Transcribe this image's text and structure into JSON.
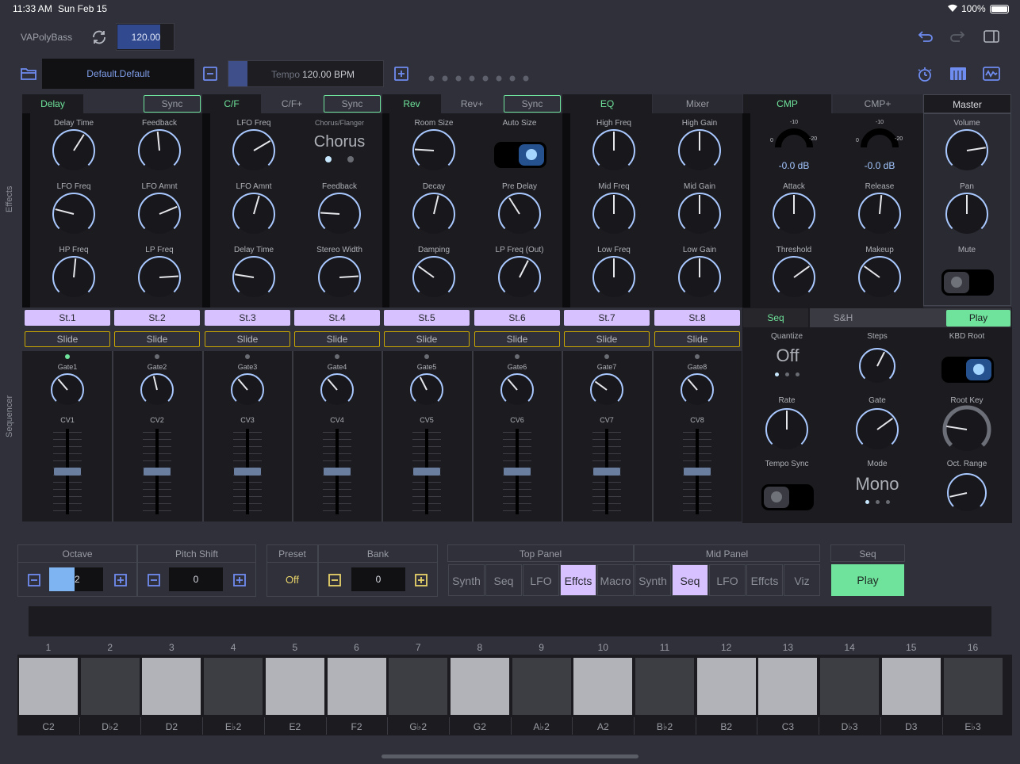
{
  "status_bar": {
    "time": "11:33 AM",
    "date": "Sun Feb 15",
    "battery": "100%"
  },
  "toolbar": {
    "preset_name": "VAPolyBass",
    "tempo_value": "120.00",
    "patch_name": "Default.Default",
    "tempo_label": "Tempo",
    "tempo_bpm": "120.00 BPM",
    "page_dots": 8
  },
  "effects_side_label": "Effects",
  "sequencer_side_label": "Sequencer",
  "effect_tabs": [
    {
      "label": "Delay",
      "active": true
    },
    {
      "label": "Sync",
      "outlined": true
    },
    {
      "label": "C/F",
      "active": true
    },
    {
      "label": "C/F+"
    },
    {
      "label": "Sync",
      "outlined": true
    },
    {
      "label": "Rev",
      "active": true
    },
    {
      "label": "Rev+"
    },
    {
      "label": "Sync",
      "outlined": true
    },
    {
      "label": "EQ",
      "active": true
    },
    {
      "label": "Mixer"
    },
    {
      "label": "CMP",
      "active": true
    },
    {
      "label": "CMP+"
    },
    {
      "label": "Master",
      "active_white": true
    }
  ],
  "knob_labels": {
    "delay": [
      "Delay Time",
      "Feedback",
      "LFO Freq",
      "LFO Amnt",
      "HP Freq",
      "LP Freq"
    ],
    "chorus": [
      "LFO Freq",
      "LFO Amnt",
      "Feedback",
      "Delay Time",
      "Stereo Width"
    ],
    "chorus_small_label": "Chorus/Flanger",
    "chorus_mode": "Chorus",
    "reverb": [
      "Room Size",
      "Auto Size",
      "Decay",
      "Pre Delay",
      "Damping",
      "LP Freq (Out)"
    ],
    "eq": [
      "High Freq",
      "High Gain",
      "Mid Freq",
      "Mid Gain",
      "Low Freq",
      "Low Gain"
    ],
    "cmp": [
      "Attack",
      "Release",
      "Threshold",
      "Makeup"
    ],
    "cmp_meters": [
      {
        "left": "0",
        "top": "-10",
        "right": "-20",
        "value": "-0.0 dB"
      },
      {
        "left": "0",
        "top": "-10",
        "right": "-20",
        "value": "-0.0 dB"
      }
    ],
    "master": [
      "Volume",
      "Pan",
      "Mute"
    ]
  },
  "steps": {
    "labels": [
      "St.1",
      "St.2",
      "St.3",
      "St.4",
      "St.5",
      "St.6",
      "St.7",
      "St.8"
    ],
    "slide_label": "Slide",
    "gates": [
      "Gate1",
      "Gate2",
      "Gate3",
      "Gate4",
      "Gate5",
      "Gate6",
      "Gate7",
      "Gate8"
    ],
    "cvs": [
      "CV1",
      "CV2",
      "CV3",
      "CV4",
      "CV5",
      "CV6",
      "CV7",
      "CV8"
    ]
  },
  "seq_panel": {
    "tabs": [
      "Seq",
      "S&H"
    ],
    "play": "Play",
    "labels": [
      "Quantize",
      "Steps",
      "KBD Root",
      "Rate",
      "Gate",
      "Root Key",
      "Tempo Sync",
      "Mode",
      "Oct. Range"
    ],
    "quantize_value": "Off",
    "mode_value": "Mono"
  },
  "bottom": {
    "octave_label": "Octave",
    "octave_value": "2",
    "pitch_label": "Pitch Shift",
    "pitch_value": "0",
    "preset_label": "Preset",
    "preset_value": "Off",
    "bank_label": "Bank",
    "bank_value": "0",
    "top_panel_label": "Top Panel",
    "mid_panel_label": "Mid Panel",
    "seq_label": "Seq",
    "play_label": "Play",
    "top_segments": [
      "Synth",
      "Seq",
      "LFO",
      "Effcts",
      "Macro"
    ],
    "mid_segments": [
      "Synth",
      "Seq",
      "LFO",
      "Effcts",
      "Viz"
    ]
  },
  "keyboard": {
    "numbers": [
      "1",
      "2",
      "3",
      "4",
      "5",
      "6",
      "7",
      "8",
      "9",
      "10",
      "11",
      "12",
      "13",
      "14",
      "15",
      "16"
    ],
    "notes": [
      "C2",
      "D♭2",
      "D2",
      "E♭2",
      "E2",
      "F2",
      "G♭2",
      "G2",
      "A♭2",
      "A2",
      "B♭2",
      "B2",
      "C3",
      "D♭3",
      "D3",
      "E♭3"
    ]
  },
  "colors": {
    "accent_green": "#6fe39b",
    "accent_lilac": "#d7c2ff",
    "accent_blue": "#6f8cf0",
    "slide_gold": "#c9a700"
  }
}
